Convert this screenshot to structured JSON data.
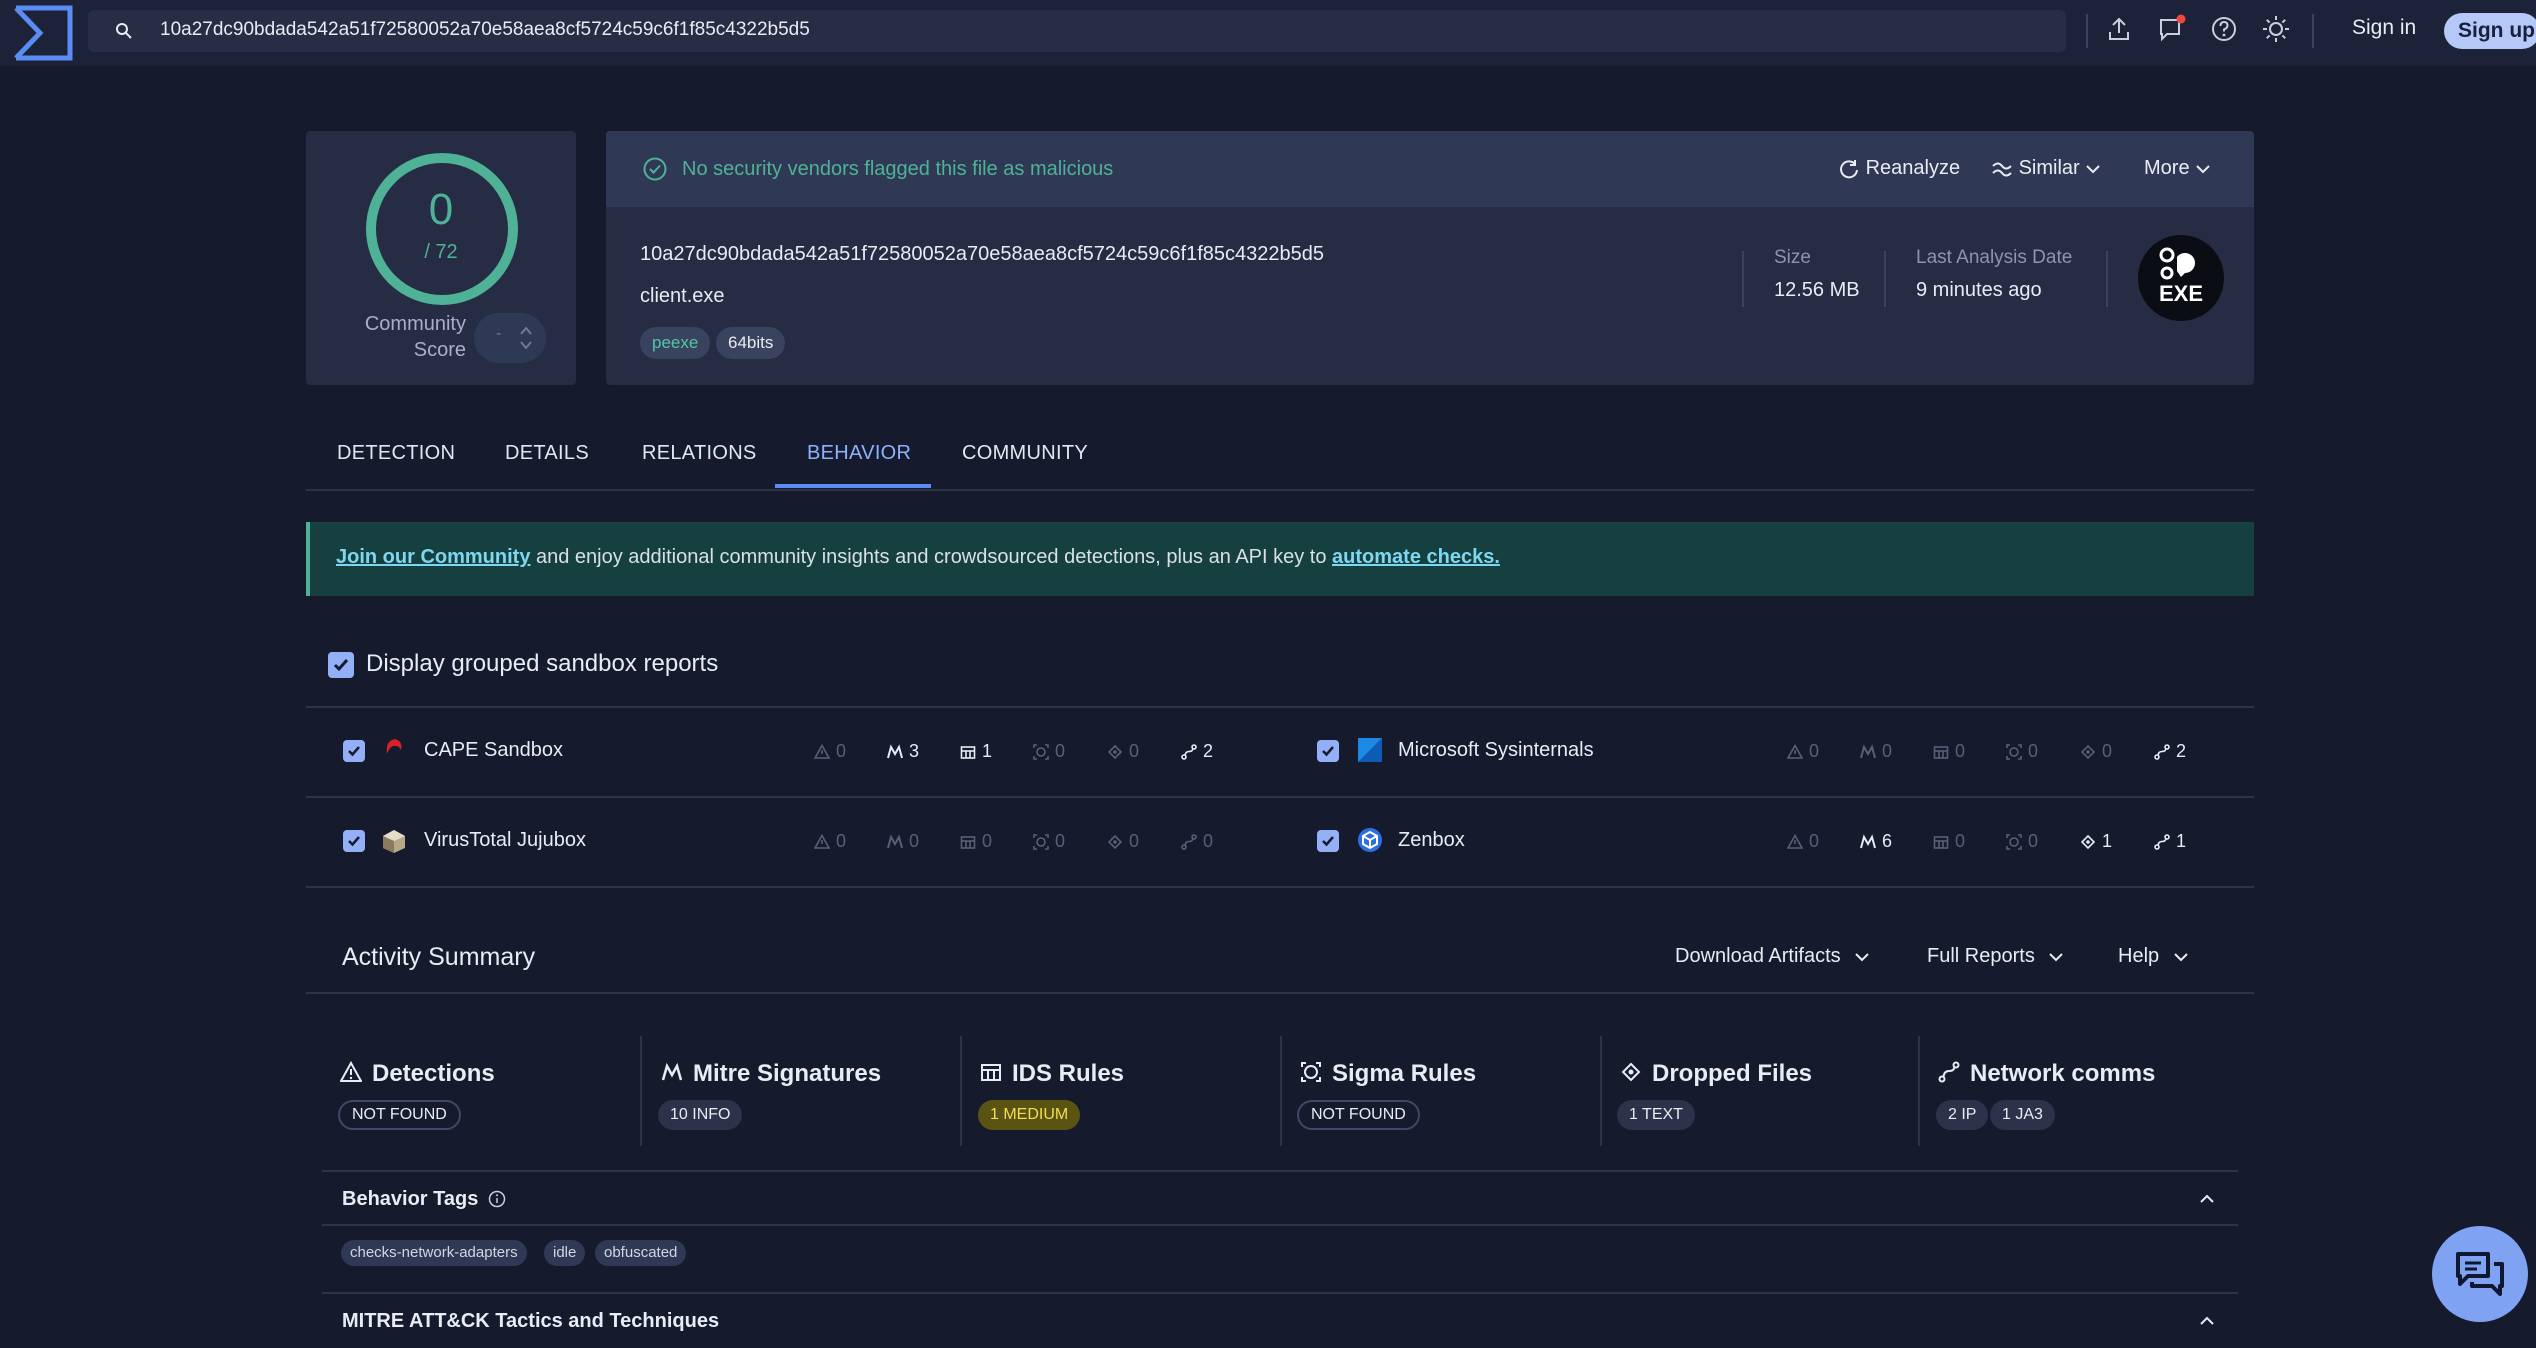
{
  "topbar": {
    "search_value": "10a27dc90bdada542a51f72580052a70e58aea8cf5724c59c6f1f85c4322b5d5",
    "signin_label": "Sign in",
    "signup_label": "Sign up"
  },
  "score": {
    "detections": "0",
    "total": "/ 72",
    "community_label_1": "Community",
    "community_label_2": "Score",
    "vote_value": "-"
  },
  "header": {
    "status_text": "No security vendors flagged this file as malicious",
    "reanalyze_label": "Reanalyze",
    "similar_label": "Similar",
    "more_label": "More",
    "status_color": "#4fb296"
  },
  "file": {
    "hash": "10a27dc90bdada542a51f72580052a70e58aea8cf5724c59c6f1f85c4322b5d5",
    "name": "client.exe",
    "tags": [
      "peexe",
      "64bits"
    ],
    "size_label": "Size",
    "size_value": "12.56 MB",
    "date_label": "Last Analysis Date",
    "date_value": "9 minutes ago",
    "type_badge": "EXE"
  },
  "tabs": [
    "DETECTION",
    "DETAILS",
    "RELATIONS",
    "BEHAVIOR",
    "COMMUNITY"
  ],
  "active_tab": "BEHAVIOR",
  "banner": {
    "link1": "Join our Community",
    "middle": " and enjoy additional community insights and crowdsourced detections, plus an API key to ",
    "link2": "automate checks."
  },
  "sandboxes": {
    "grouped_label": "Display grouped sandbox reports",
    "items": [
      {
        "name": "CAPE Sandbox",
        "stats": [
          "0",
          "3",
          "1",
          "0",
          "0",
          "2"
        ]
      },
      {
        "name": "Microsoft Sysinternals",
        "stats": [
          "0",
          "0",
          "0",
          "0",
          "0",
          "2"
        ]
      },
      {
        "name": "VirusTotal Jujubox",
        "stats": [
          "0",
          "0",
          "0",
          "0",
          "0",
          "0"
        ]
      },
      {
        "name": "Zenbox",
        "stats": [
          "0",
          "6",
          "0",
          "0",
          "1",
          "1"
        ]
      }
    ]
  },
  "activity": {
    "title": "Activity Summary",
    "download_label": "Download Artifacts",
    "reports_label": "Full Reports",
    "help_label": "Help",
    "categories": [
      {
        "title": "Detections",
        "badges": [
          "NOT FOUND"
        ]
      },
      {
        "title": "Mitre Signatures",
        "badges": [
          "10 INFO"
        ]
      },
      {
        "title": "IDS Rules",
        "badges": [
          "1 MEDIUM"
        ]
      },
      {
        "title": "Sigma Rules",
        "badges": [
          "NOT FOUND"
        ]
      },
      {
        "title": "Dropped Files",
        "badges": [
          "1 TEXT"
        ]
      },
      {
        "title": "Network comms",
        "badges": [
          "2 IP",
          "1 JA3"
        ]
      }
    ],
    "behavior_tags_title": "Behavior Tags",
    "behavior_tags": [
      "checks-network-adapters",
      "idle",
      "obfuscated"
    ],
    "mitre_title": "MITRE ATT&CK Tactics and Techniques"
  }
}
